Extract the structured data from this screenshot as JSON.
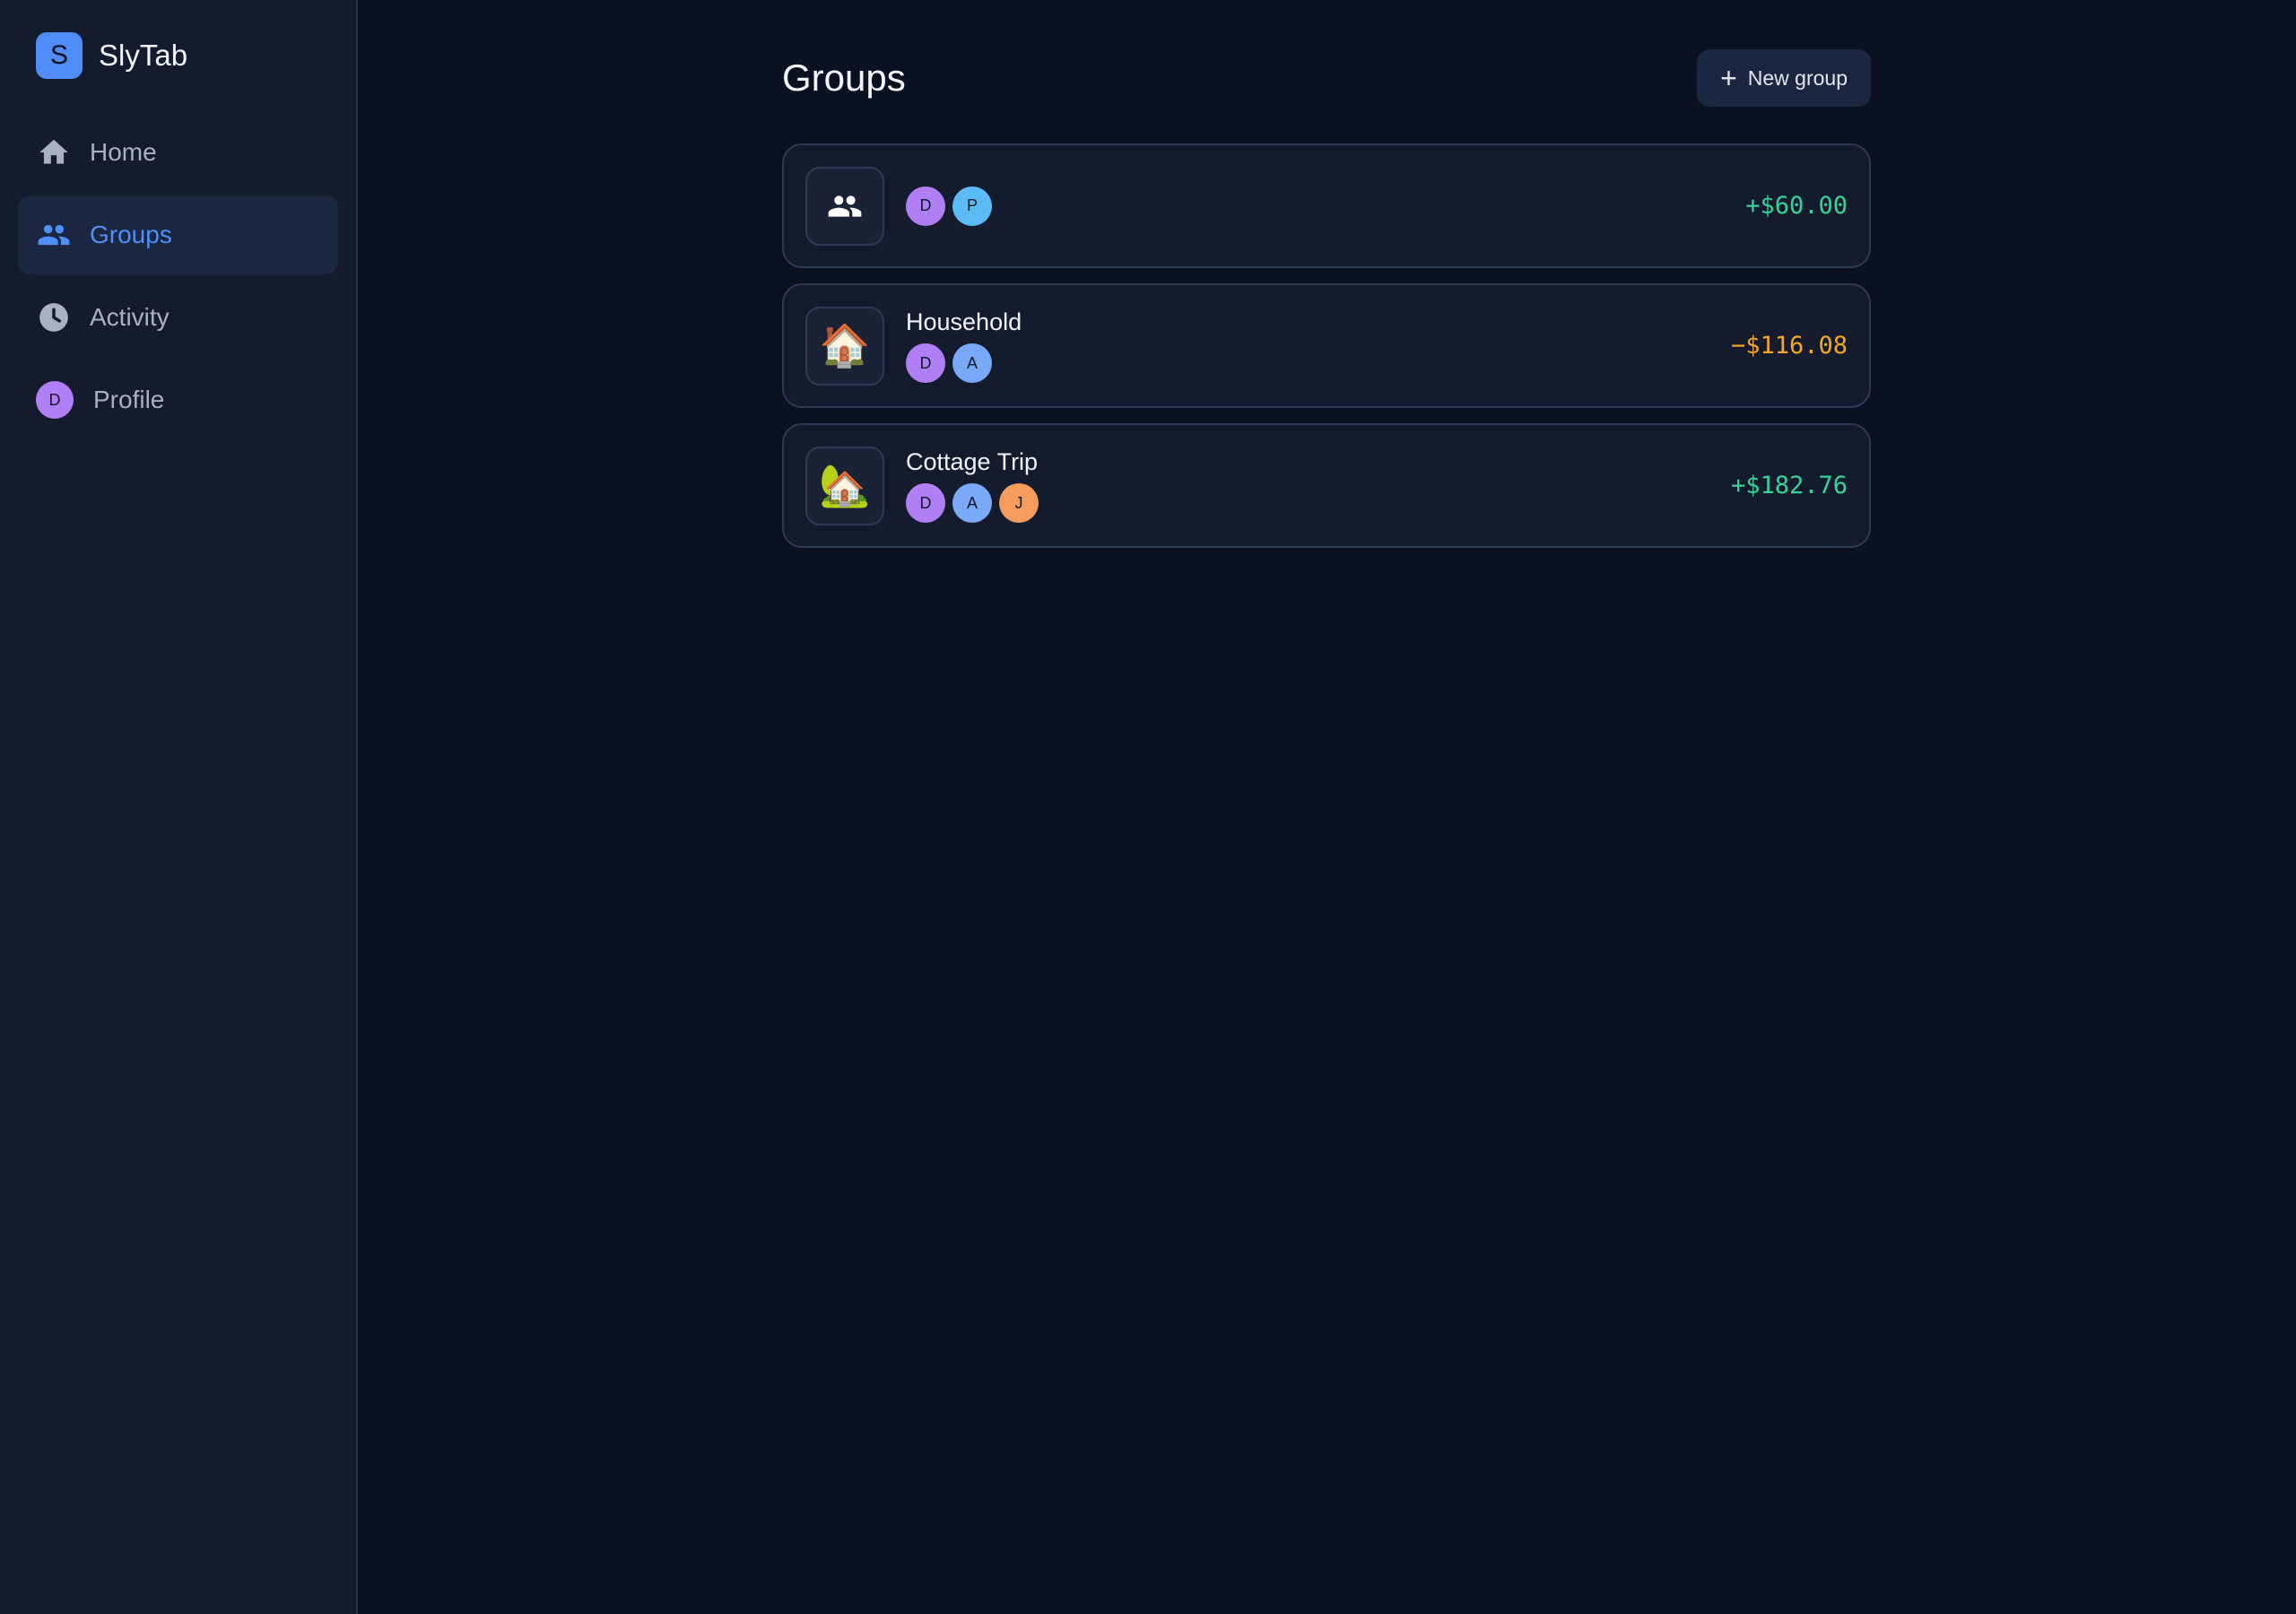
{
  "app": {
    "logo_letter": "S",
    "name": "SlyTab"
  },
  "sidebar": {
    "items": [
      {
        "label": "Home",
        "icon": "home-icon",
        "active": false
      },
      {
        "label": "Groups",
        "icon": "users-icon",
        "active": true
      },
      {
        "label": "Activity",
        "icon": "clock-icon",
        "active": false
      },
      {
        "label": "Profile",
        "icon": "avatar",
        "avatar_letter": "D",
        "active": false
      }
    ]
  },
  "main": {
    "title": "Groups",
    "new_group_label": "New group",
    "new_group_icon": "plus-icon"
  },
  "groups": [
    {
      "name": "",
      "icon": "users-icon",
      "members": [
        {
          "letter": "D",
          "color": "#b17ff5"
        },
        {
          "letter": "P",
          "color": "#5bbcf5"
        }
      ],
      "balance": "+$60.00",
      "balance_color": "#34d399"
    },
    {
      "name": "Household",
      "icon": "🏠",
      "members": [
        {
          "letter": "D",
          "color": "#b17ff5"
        },
        {
          "letter": "A",
          "color": "#79a8f7"
        }
      ],
      "balance": "−$116.08",
      "balance_color": "#f5a623"
    },
    {
      "name": "Cottage Trip",
      "icon": "🏡",
      "members": [
        {
          "letter": "D",
          "color": "#b17ff5"
        },
        {
          "letter": "A",
          "color": "#79a8f7"
        },
        {
          "letter": "J",
          "color": "#f59b5c"
        }
      ],
      "balance": "+$182.76",
      "balance_color": "#34d399"
    }
  ],
  "colors": {
    "accent": "#4f8cf5",
    "background": "#0b1120",
    "sidebar": "#141b2d",
    "positive": "#34d399",
    "negative": "#f5a623"
  }
}
